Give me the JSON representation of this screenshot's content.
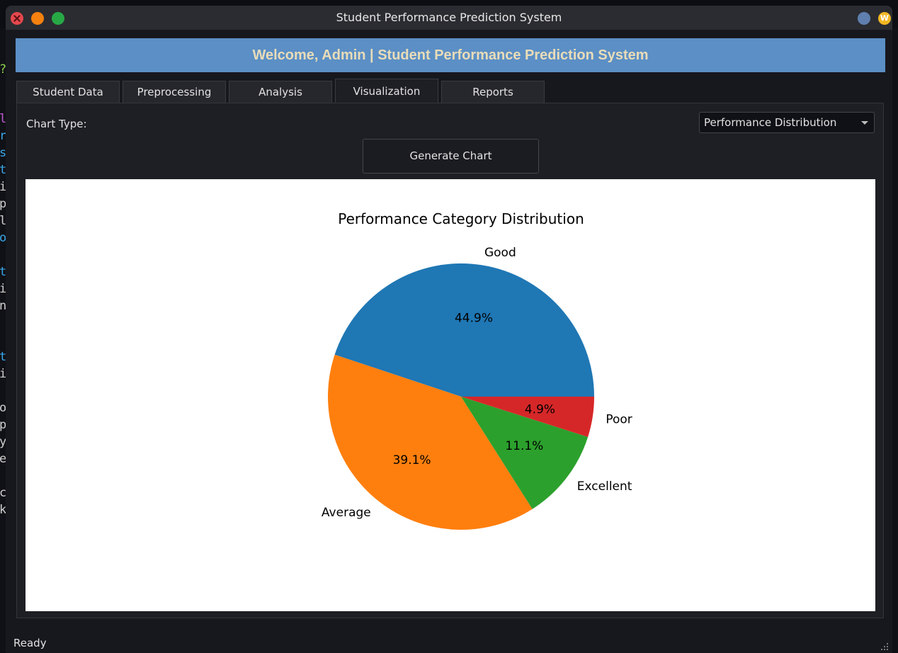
{
  "window": {
    "title": "Student Performance Prediction System"
  },
  "banner": {
    "text": "Welcome, Admin | Student Performance Prediction System"
  },
  "tabs": [
    {
      "label": "Student Data"
    },
    {
      "label": "Preprocessing"
    },
    {
      "label": "Analysis"
    },
    {
      "label": "Visualization",
      "active": true
    },
    {
      "label": "Reports"
    }
  ],
  "controls": {
    "chart_type_label": "Chart Type:",
    "chart_type_selected": "Performance Distribution",
    "generate_label": "Generate Chart"
  },
  "status": {
    "text": "Ready"
  },
  "colors": {
    "banner_bg": "#5b8fc5",
    "banner_text": "#e9dcb9",
    "good": "#1f77b4",
    "average": "#ff7f0e",
    "excellent": "#2ca02c",
    "poor": "#d62728"
  },
  "chart_data": {
    "type": "pie",
    "title": "Performance Category Distribution",
    "categories": [
      "Good",
      "Average",
      "Excellent",
      "Poor"
    ],
    "values": [
      44.9,
      39.1,
      11.1,
      4.9
    ],
    "labels": [
      "44.9%",
      "39.1%",
      "11.1%",
      "4.9%"
    ],
    "colors": [
      "#1f77b4",
      "#ff7f0e",
      "#2ca02c",
      "#d62728"
    ],
    "start_angle_deg": 0,
    "direction": "counterclockwise"
  }
}
